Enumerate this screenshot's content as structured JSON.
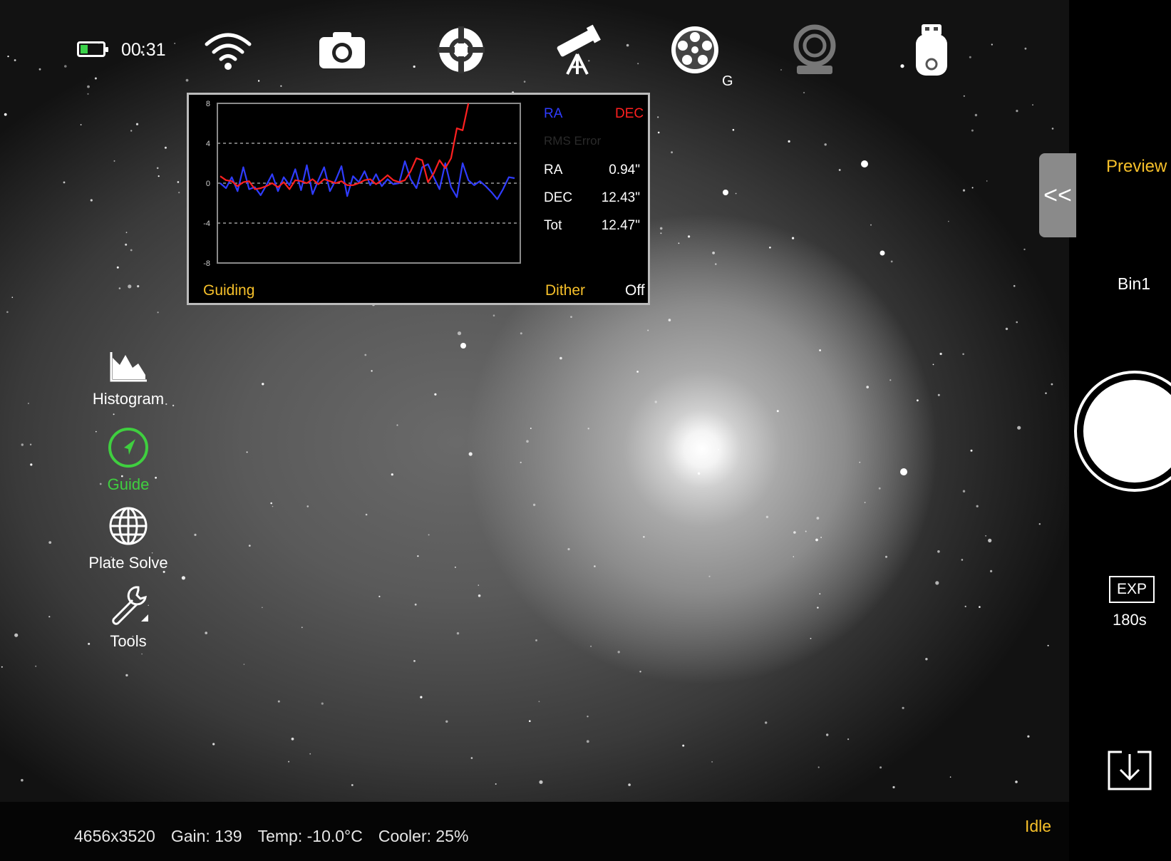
{
  "status": {
    "battery_color": "#3bd14a",
    "clock": "00:31"
  },
  "toolbar": {
    "icons": [
      "wifi-icon",
      "camera-icon",
      "focus-crosshair-icon",
      "telescope-mount-icon",
      "filter-wheel-icon",
      "guide-camera-icon",
      "usb-storage-icon",
      "more-icon"
    ],
    "filter_wheel_badge": "G"
  },
  "guiding_panel": {
    "legend_ra": "RA",
    "legend_dec": "DEC",
    "rms_title": "RMS Error",
    "rows": [
      {
        "label": "RA",
        "value": "0.94\""
      },
      {
        "label": "DEC",
        "value": "12.43\""
      },
      {
        "label": "Tot",
        "value": "12.47\""
      }
    ],
    "guiding_label": "Guiding",
    "dither_label": "Dither",
    "dither_value": "Off",
    "colors": {
      "ra": "#2f3cff",
      "dec": "#ff2020",
      "accent": "#f6c02a"
    }
  },
  "chart_data": {
    "type": "line",
    "ylim": [
      -8,
      8
    ],
    "yticks": [
      "8",
      "4",
      "0",
      "-4",
      "-8"
    ],
    "grid": true,
    "series": [
      {
        "name": "RA",
        "color": "#2f3cff",
        "values": [
          0,
          -0.5,
          0.6,
          -0.8,
          1.6,
          -0.6,
          -0.4,
          -1.2,
          -0.2,
          0.9,
          -0.8,
          0.6,
          -0.2,
          1.4,
          -0.7,
          1.8,
          -1.1,
          0.3,
          1.6,
          -0.8,
          0.3,
          1.7,
          -1.3,
          0.7,
          0.1,
          1.2,
          -0.2,
          0.9,
          -0.3,
          0.4,
          -0.1,
          0,
          2.2,
          0.4,
          -0.5,
          1.6,
          1.9,
          0.6,
          -0.6,
          2.0,
          -0.4,
          -1.4,
          2.0,
          0.3,
          -0.2,
          0.2,
          -0.3,
          -0.9,
          -1.6,
          -0.6,
          0.6,
          0.5
        ]
      },
      {
        "name": "DEC",
        "color": "#ff2020",
        "values": [
          0.7,
          0.3,
          0.2,
          -0.3,
          0.1,
          0.2,
          -0.6,
          -0.5,
          -0.3,
          0,
          -0.4,
          0.1,
          -0.6,
          0.3,
          0.2,
          0,
          0.4,
          -0.1,
          0.4,
          0.2,
          0,
          0.2,
          -0.2,
          -0.2,
          0,
          0.3,
          0.4,
          -0.1,
          0.3,
          0.8,
          0.3,
          0.1,
          0.3,
          1.2,
          2.5,
          2.3,
          0.1,
          1.0,
          2.3,
          1.5,
          2.5,
          5.5,
          5.3,
          8.6
        ]
      }
    ]
  },
  "side_tools": [
    {
      "id": "histogram",
      "label": "Histogram",
      "color": "#ffffff"
    },
    {
      "id": "guide",
      "label": "Guide",
      "color": "#3fcf3f"
    },
    {
      "id": "plate-solve",
      "label": "Plate Solve",
      "color": "#ffffff"
    },
    {
      "id": "tools",
      "label": "Tools",
      "color": "#ffffff"
    }
  ],
  "right_panel": {
    "collapse_glyph": "<<",
    "mode": "Preview",
    "binning": "Bin1",
    "exposure_label": "EXP",
    "exposure_value": "180s"
  },
  "footer": {
    "resolution": "4656x3520",
    "gain": "Gain: 139",
    "temp": "Temp: -10.0°C",
    "cooler": "Cooler: 25%",
    "state": "Idle"
  }
}
